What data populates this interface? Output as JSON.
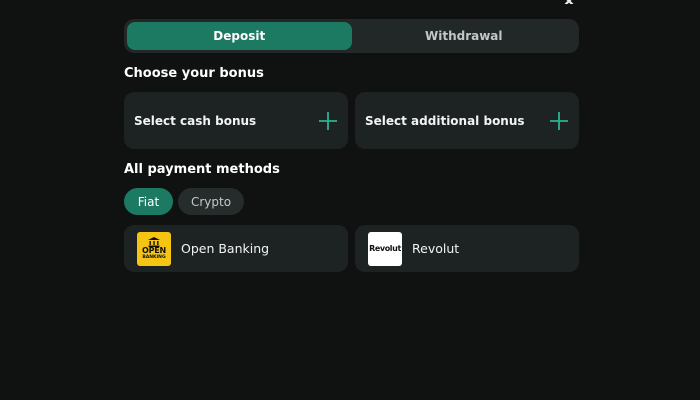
{
  "tabs": {
    "deposit": "Deposit",
    "withdrawal": "Withdrawal"
  },
  "bonus": {
    "title": "Choose your bonus",
    "cash_label": "Select cash bonus",
    "additional_label": "Select additional bonus"
  },
  "payment": {
    "title": "All payment methods",
    "filters": [
      "Fiat",
      "Crypto"
    ],
    "methods": [
      {
        "name": "Open Banking",
        "logo_line1": "OPEN",
        "logo_line2": "BANKING"
      },
      {
        "name": "Revolut",
        "logo_text": "Revolut"
      }
    ]
  },
  "colors": {
    "background": "#101212",
    "accent": "#1c7a63",
    "card": "#1d2222",
    "plus_icon": "#2bb391",
    "open_banking_yellow": "#f6c514"
  },
  "icons": {
    "close": "close-icon",
    "plus": "plus-icon",
    "bank": "bank-icon"
  }
}
